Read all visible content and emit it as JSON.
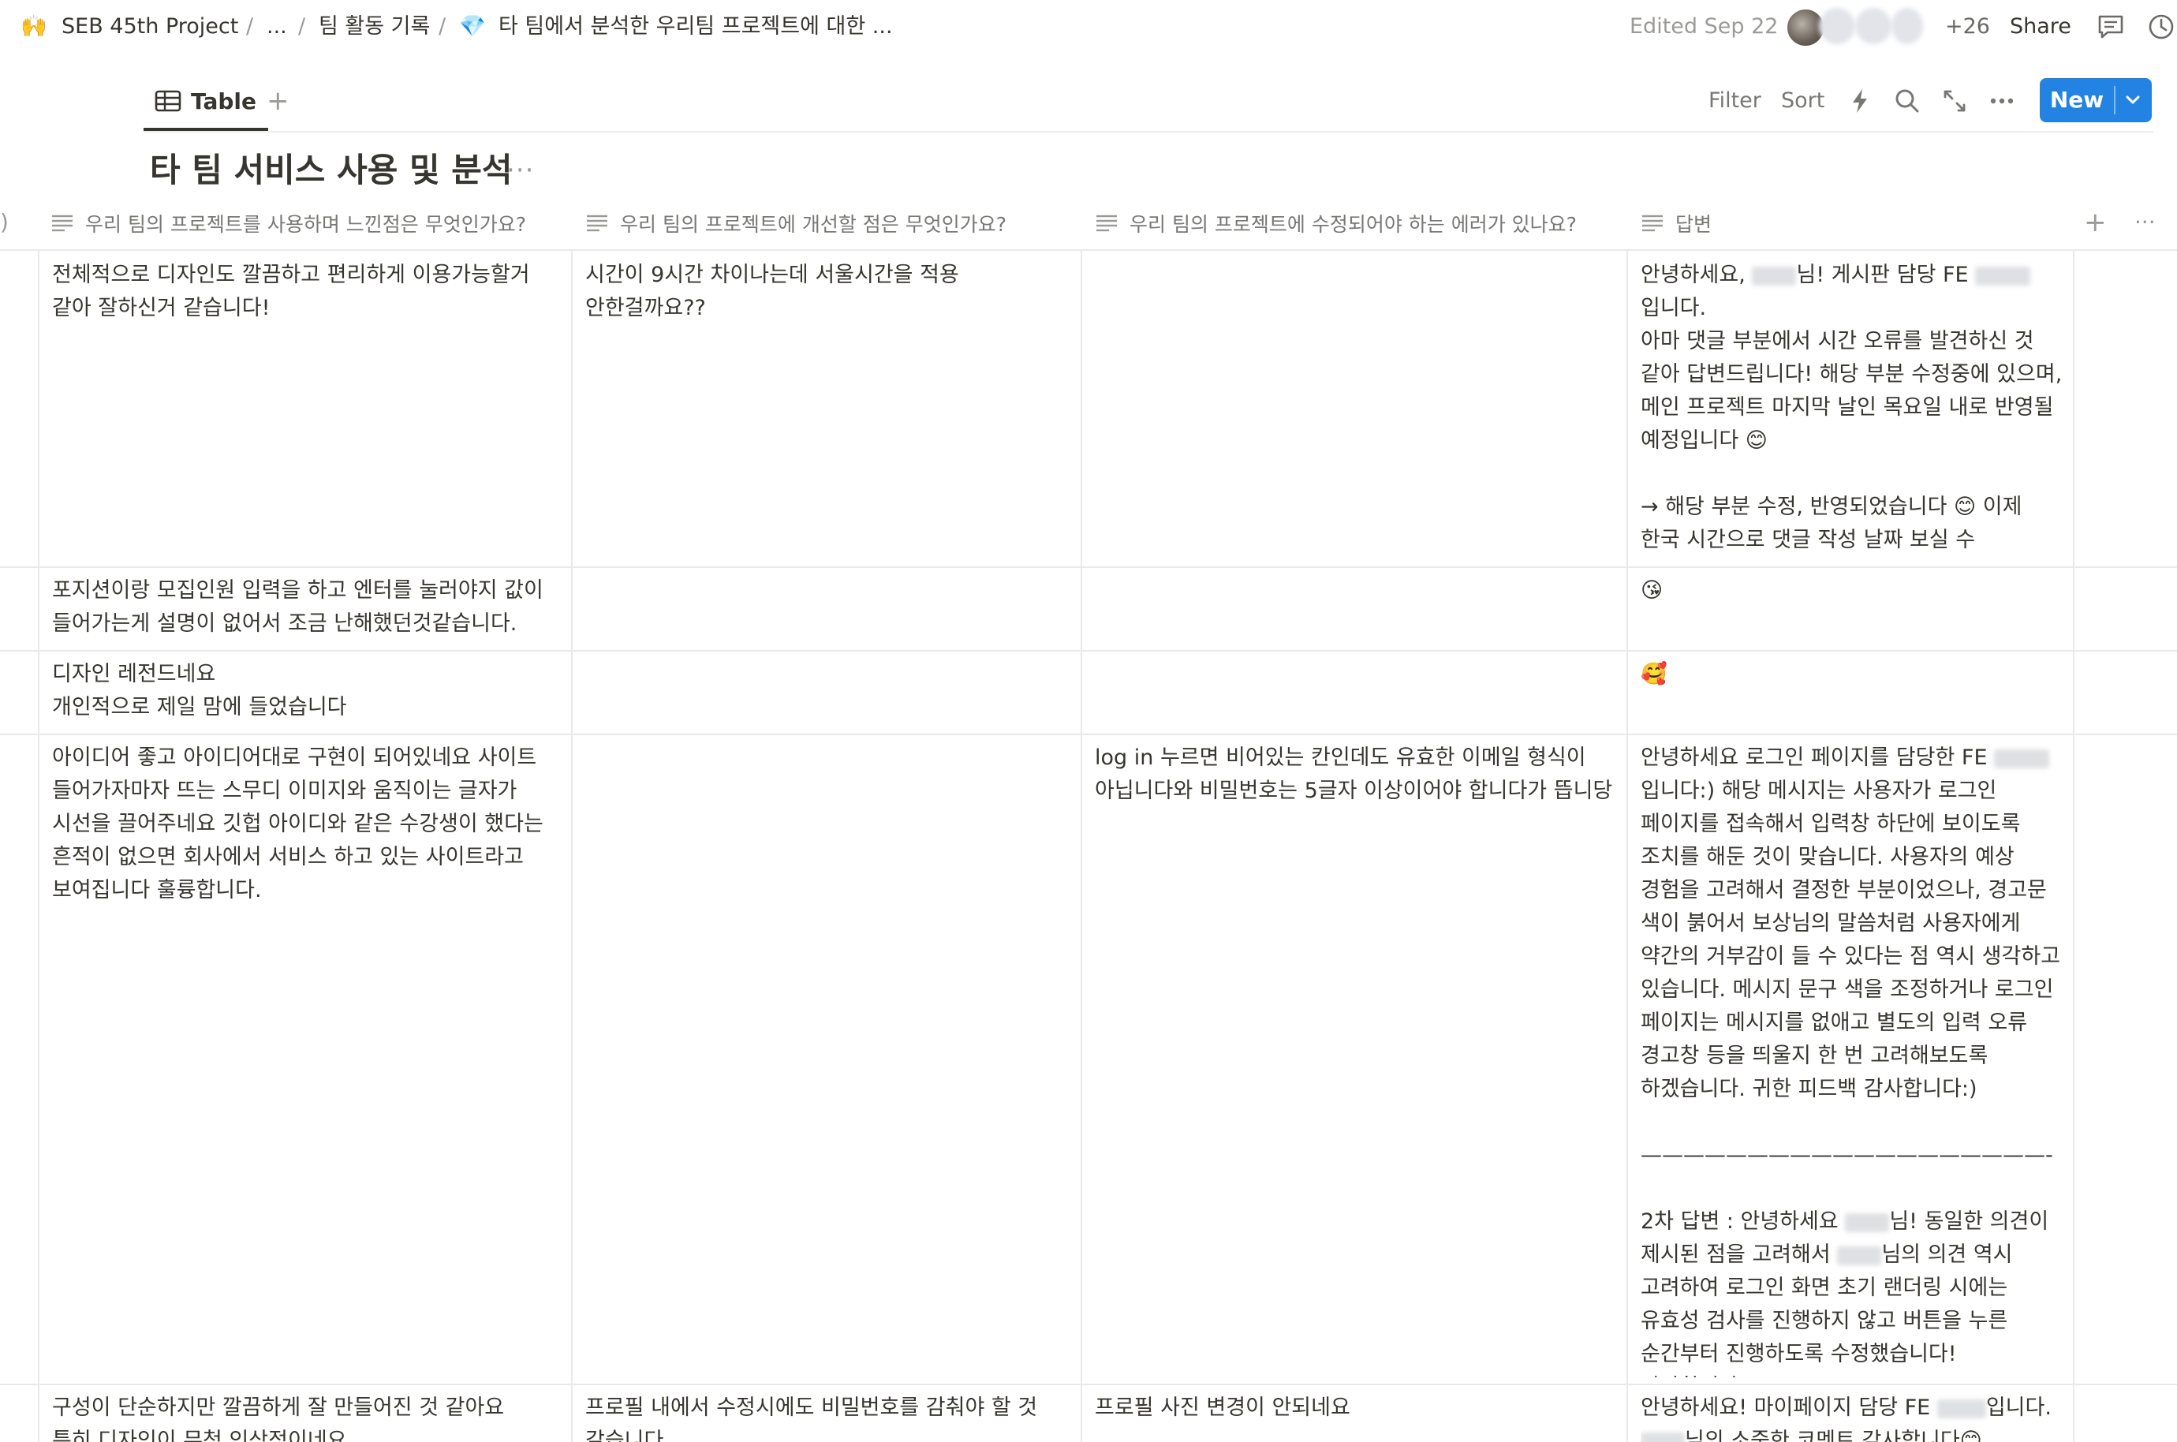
{
  "breadcrumb": {
    "workspace_icon": "🙌",
    "workspace": "SEB 45th Project",
    "separator": "/",
    "ellipsis": "...",
    "parent": "팀 활동 기록",
    "page_icon": "💎",
    "page": "타 팀에서 분석한 우리팀 프로젝트에 대한 ..."
  },
  "header": {
    "edited": "Edited Sep 22",
    "extra_count": "+26",
    "share_label": "Share",
    "icons": [
      "comments-icon",
      "history-icon"
    ]
  },
  "viewbar": {
    "tab_label": "Table",
    "add_view": "+",
    "filter_label": "Filter",
    "sort_label": "Sort",
    "new_label": "New",
    "icons": [
      "lightning-icon",
      "search-icon",
      "expand-icon",
      "more-icon"
    ]
  },
  "database": {
    "title": "타 팀 서비스 사용 및 분석",
    "more": "···",
    "left_edge_marker": ")"
  },
  "table": {
    "columns": [
      "우리 팀의 프로젝트를 사용하며 느낀점은 무엇인가요?",
      "우리 팀의 프로젝트에 개선할 점은 무엇인가요?",
      "우리 팀의 프로젝트에 수정되어야 하는 에러가 있나요?",
      "답변"
    ],
    "add_column": "+",
    "column_more": "···",
    "rows": [
      {
        "c1": "전체적으로 디자인도 깔끔하고 편리하게 이용가능할거 같아 잘하신거 같습니다!",
        "c2": "시간이 9시간 차이나는데 서울시간을 적용 안한걸까요??",
        "c3": "",
        "answer": {
          "a1": "안녕하세요, ",
          "a2": "님! 게시판 담당 FE ",
          "a3": "입니다.",
          "a4": "아마 댓글 부분에서 시간 오류를 발견하신 것 같아 답변드립니다! 해당 부분 수정중에 있으며, 메인 프로젝트 마지막 날인 목요일 내로 반영될 예정입니다 😊",
          "a5": "→ 해당 부분 수정, 반영되었습니다 😊 이제 한국 시간으로 댓글 작성 날짜 보실 수 있으세요!"
        }
      },
      {
        "c1": "포지션이랑 모집인원 입력을 하고 엔터를 눌러야지 값이 들어가는게 설명이 없어서 조금 난해했던것같습니다.",
        "c2": "",
        "c3": "",
        "answer_emoji": "😘"
      },
      {
        "c1": "디자인 레전드네요\n개인적으로 제일 맘에 들었습니다",
        "c2": "",
        "c3": "",
        "answer_emoji": "🥰"
      },
      {
        "c1": "아이디어 좋고 아이디어대로 구현이 되어있네요 사이트 들어가자마자 뜨는 스무디 이미지와 움직이는 글자가 시선을 끌어주네요 깃헙 아이디와 같은 수강생이 했다는 흔적이 없으면 회사에서 서비스 하고 있는 사이트라고 보여집니다 훌륭합니다.",
        "c2": "",
        "c3": "log in 누르면 비어있는 칸인데도 유효한 이메일 형식이 아닙니다와 비밀번호는 5글자 이상이어야 합니다가 뜹니당",
        "answer": {
          "a1": "안녕하세요 로그인 페이지를 담당한 FE ",
          "a2": "입니다:) 해당 메시지는 사용자가 로그인 페이지를 접속해서 입력창 하단에 보이도록 조치를 해둔 것이 맞습니다. 사용자의 예상 경험을 고려해서 결정한 부분이었으나, 경고문 색이 붉어서 보상",
          "a3": "님의 말씀처럼 사용자에게 약간의 거부감이 들 수 있다는 점 역시 생각하고 있습니다. 메시지 문구 색을 조정하거나 로그인 페이지는 메시지를 없애고 별도의 입력 오류 경고창 등을 띄울지 한 번 고려해보도록 하겠습니다. 귀한 피드백 감사합니다:)",
          "divider": "———————————————————-",
          "a4": "2차 답변 : 안녕하세요 ",
          "a5": "님! 동일한 의견이 제시된 점을 고려해서 ",
          "a6": "님의 의견 역시 고려하여 로그인 화면 초기 랜더링 시에는 유효성 검사를 진행하지 않고 버튼을 누른 순간부터 진행하도록 수정했습니다! 감사합니다:)"
        }
      },
      {
        "c1": "구성이 단순하지만 깔끔하게 잘 만들어진 것 같아요\n특히 디자인이 무척 인상적이네요",
        "c2": "프로필 내에서 수정시에도 비밀번호를 감춰야 할 것 같습니다",
        "c3": "프로필 사진 변경이 안되네요",
        "answer": {
          "a1": "안녕하세요! 마이페이지 담당 FE ",
          "a2": "입니다.",
          "a3": "님의 소중한 코멘트 감사합니다😊"
        }
      }
    ]
  }
}
